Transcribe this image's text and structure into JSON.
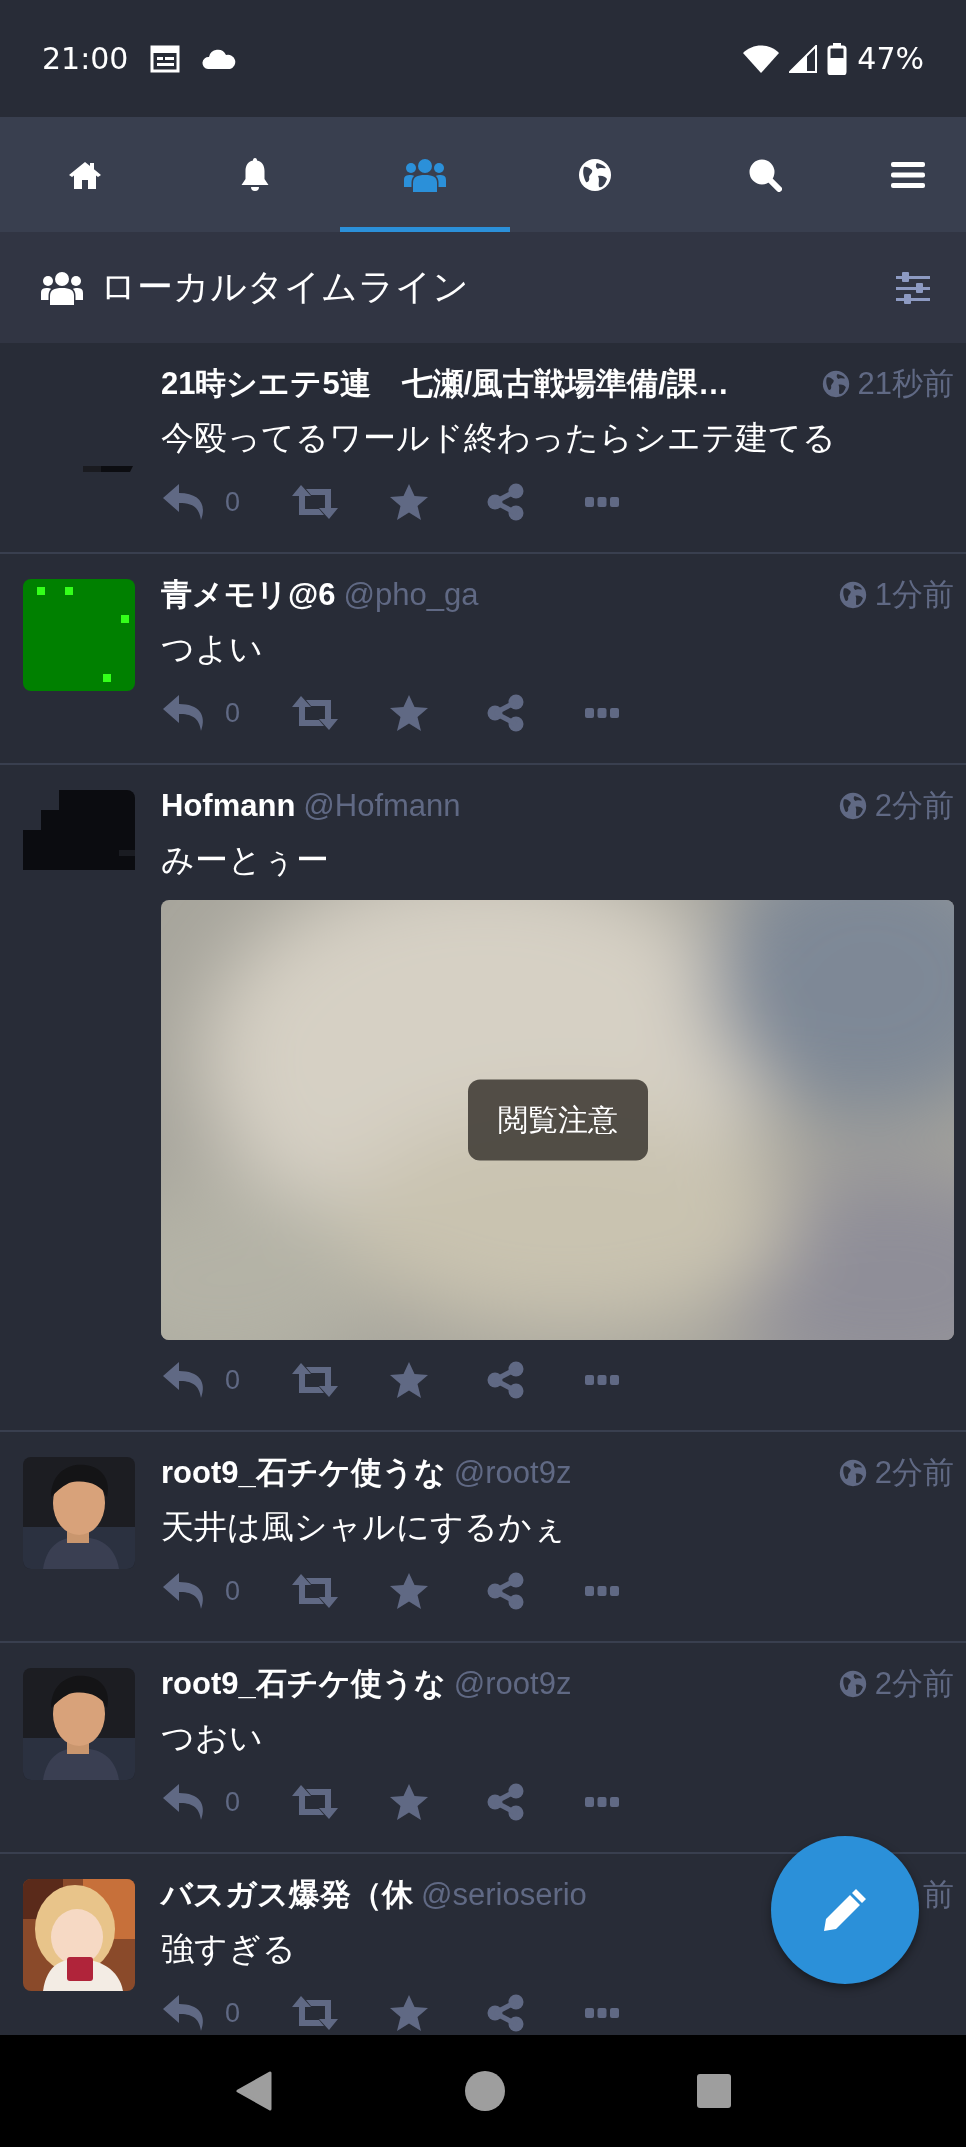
{
  "status_bar": {
    "time": "21:00",
    "battery": "47%"
  },
  "tabs": [
    {
      "kind": "home",
      "selected": false
    },
    {
      "kind": "bell",
      "selected": false
    },
    {
      "kind": "users",
      "selected": true
    },
    {
      "kind": "globe",
      "selected": false
    },
    {
      "kind": "search",
      "selected": false
    },
    {
      "kind": "menu",
      "selected": false
    }
  ],
  "header": {
    "title": "ローカルタイムライン"
  },
  "posts": [
    {
      "display_name": "21時シエテ5連　七瀬/風古戦場準備/課…",
      "time": "21秒前",
      "globe": true,
      "text": "今殴ってるワールド終わったらシエテ建てる",
      "replies": "0"
    },
    {
      "display_name": "青メモリ@6",
      "handle": "@pho_ga",
      "time": "1分前",
      "globe": true,
      "text": "つよい",
      "replies": "0"
    },
    {
      "display_name": "Hofmann",
      "handle": "@Hofmann",
      "time": "2分前",
      "globe": true,
      "text": "みーとぅー",
      "media": {
        "kind": "picture",
        "warning": "閲覧注意"
      },
      "replies": "0"
    },
    {
      "display_name": "root9_石チケ使うな",
      "handle": "@root9z",
      "time": "2分前",
      "globe": true,
      "text": "天井は風シャルにするかぇ",
      "replies": "0"
    },
    {
      "display_name": "root9_石チケ使うな",
      "handle": "@root9z",
      "time": "2分前",
      "globe": true,
      "text": "つおい",
      "replies": "0"
    },
    {
      "display_name": "バスガス爆発（休",
      "handle": "@serioserio",
      "time": "前",
      "globe": false,
      "text": "強すぎる",
      "replies": "0"
    }
  ]
}
